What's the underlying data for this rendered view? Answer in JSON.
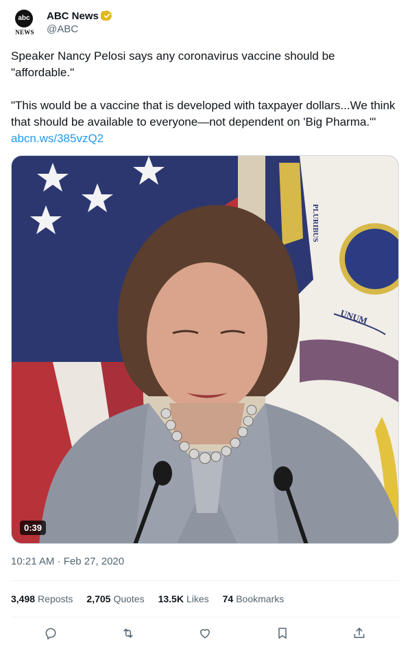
{
  "author": {
    "display_name": "ABC News",
    "handle": "@ABC",
    "avatar_text": "abc",
    "avatar_subtext": "NEWS",
    "verified_color": "#e2b719"
  },
  "tweet": {
    "text": "Speaker Nancy Pelosi says any coronavirus vaccine should be \"affordable.\"\n\n\"This would be a vaccine that is developed with taxpayer dollars...We think that should be available to everyone—not dependent on 'Big Pharma.'\" ",
    "link": "abcn.ws/385vzQ2",
    "link_color": "#1d9bf0"
  },
  "media": {
    "duration": "0:39",
    "flag_text_1": "UNUM",
    "flag_text_2": "PLURIBUS"
  },
  "timestamp": "10:21 AM · Feb 27, 2020",
  "stats": {
    "reposts_count": "3,498",
    "reposts_label": "Reposts",
    "quotes_count": "2,705",
    "quotes_label": "Quotes",
    "likes_count": "13.5K",
    "likes_label": "Likes",
    "bookmarks_count": "74",
    "bookmarks_label": "Bookmarks"
  },
  "actions": [
    "reply-icon",
    "repost-icon",
    "like-icon",
    "bookmark-icon",
    "share-icon"
  ]
}
